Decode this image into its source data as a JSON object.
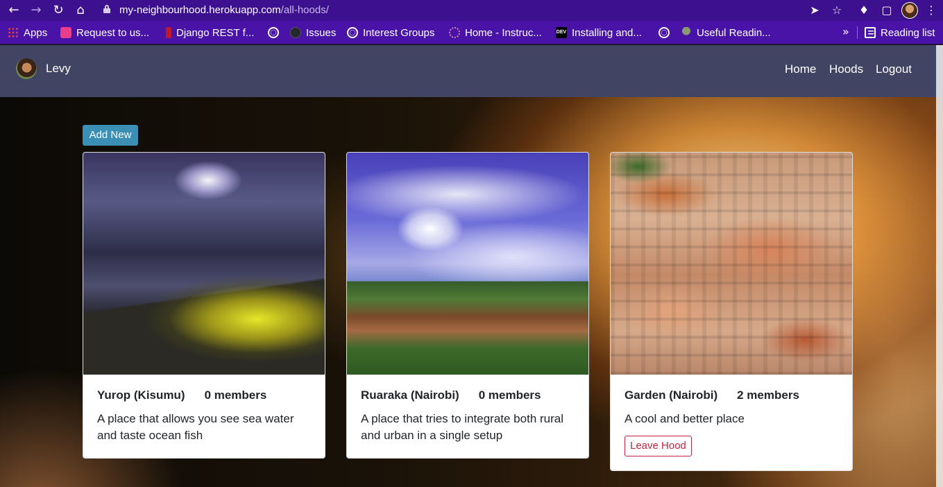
{
  "browser": {
    "url_host": "my-neighbourhood.herokuapp.com",
    "url_path": "/all-hoods/",
    "nav_icons": [
      "back-icon",
      "forward-icon",
      "reload-icon",
      "home-icon"
    ],
    "toolbar_icons": [
      "send-icon",
      "star-icon",
      "extensions-icon",
      "cast-icon",
      "menu-icon"
    ],
    "bookmarks": [
      {
        "label": "Apps",
        "icon": "apps-grid-icon"
      },
      {
        "label": "Request to us...",
        "icon": "list-icon"
      },
      {
        "label": "Django REST f...",
        "icon": "django-icon"
      },
      {
        "label": "",
        "icon": "globe-icon"
      },
      {
        "label": "Issues",
        "icon": "github-icon"
      },
      {
        "label": "Interest Groups",
        "icon": "globe-icon"
      },
      {
        "label": "Home - Instruc...",
        "icon": "wheel-icon"
      },
      {
        "label": "Installing and...",
        "icon": "dev-icon"
      },
      {
        "label": "",
        "icon": "globe-icon"
      },
      {
        "label": "Useful Readin...",
        "icon": "tree-icon"
      }
    ],
    "overflow": "»",
    "reading_list": "Reading list"
  },
  "site": {
    "username": "Levy",
    "nav": [
      "Home",
      "Hoods",
      "Logout"
    ]
  },
  "main": {
    "add_new": "Add New",
    "hoods": [
      {
        "name": "Yurop (Kisumu)",
        "members": "0 members",
        "description": "A place that allows you see sea water and taste ocean fish",
        "action": null
      },
      {
        "name": "Ruaraka (Nairobi)",
        "members": "0 members",
        "description": "A place that tries to integrate both rural and urban in a single setup",
        "action": null
      },
      {
        "name": "Garden (Nairobi)",
        "members": "2 members",
        "description": "A cool and better place",
        "action": "Leave Hood"
      }
    ]
  },
  "colors": {
    "chrome": "#3d1090",
    "bookmarks_bar": "#4a13a8",
    "navbar": "#424464",
    "primary_button": "#3b8fb4",
    "danger": "#c8233b"
  }
}
